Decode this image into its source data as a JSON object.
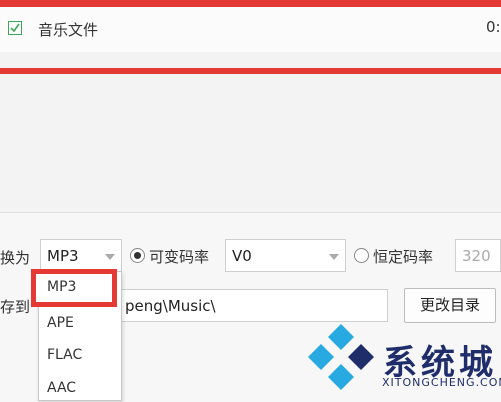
{
  "file_list": {
    "row": {
      "checked": true,
      "name": "音乐文件",
      "meta": "0:"
    }
  },
  "settings": {
    "convert_label": "换为",
    "format": {
      "selected": "MP3"
    },
    "vbr": {
      "label": "可变码率",
      "selected": true,
      "value": "V0"
    },
    "cbr": {
      "label": "恒定码率",
      "selected": false,
      "value": "320"
    },
    "save_label": "存到",
    "save_path": "peng\\Music\\",
    "change_dir_button": "更改目录"
  },
  "format_dropdown": {
    "options": [
      "MP3",
      "APE",
      "FLAC",
      "AAC"
    ],
    "highlighted_index": 0
  },
  "watermark": {
    "title": "系统城",
    "subtitle": "XITONGCHENG.COM"
  },
  "colors": {
    "accent_red": "#e53935",
    "check_green": "#3aa757",
    "watermark_blue": "#1f2d6b",
    "watermark_cyan": "#29a9e1"
  }
}
